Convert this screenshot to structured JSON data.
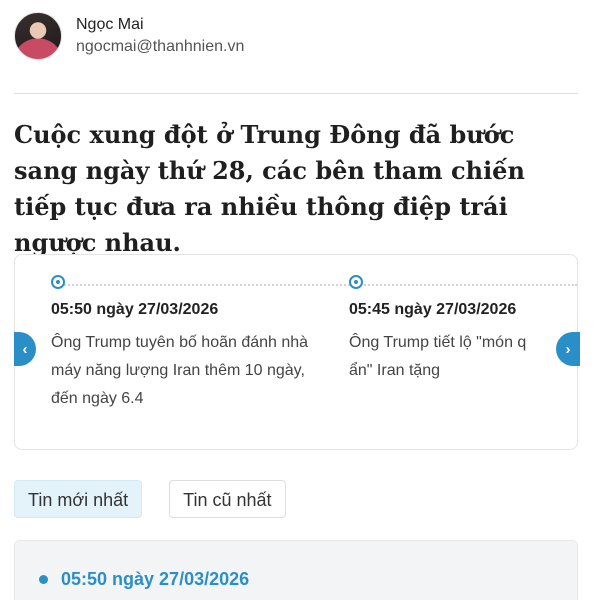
{
  "author": {
    "name": "Ngọc Mai",
    "email": "ngocmai@thanhnien.vn"
  },
  "headline": "Cuộc xung đột ở Trung Đông đã bước sang ngày thứ 28, các bên tham chiến tiếp tục đưa ra nhiều thông điệp trái ngược nhau.",
  "timeline": {
    "items": [
      {
        "time": "05:50 ngày 27/03/2026",
        "text": "Ông Trump tuyên bố hoãn đánh nhà máy năng lượng Iran thêm 10 ngày, đến ngày 6.4"
      },
      {
        "time": "05:45 ngày 27/03/2026",
        "text_line1": "Ông Trump tiết lộ \"món q",
        "text_line2": "ẩn\" Iran tặng"
      }
    ],
    "prev_icon": "chevron-left-icon",
    "next_icon": "chevron-right-icon",
    "accent_color": "#2a8fc6"
  },
  "sort_tabs": {
    "newest": "Tin mới nhất",
    "oldest": "Tin cũ nhất",
    "active": "newest"
  },
  "latest_entry": {
    "time": "05:50 ngày 27/03/2026"
  }
}
